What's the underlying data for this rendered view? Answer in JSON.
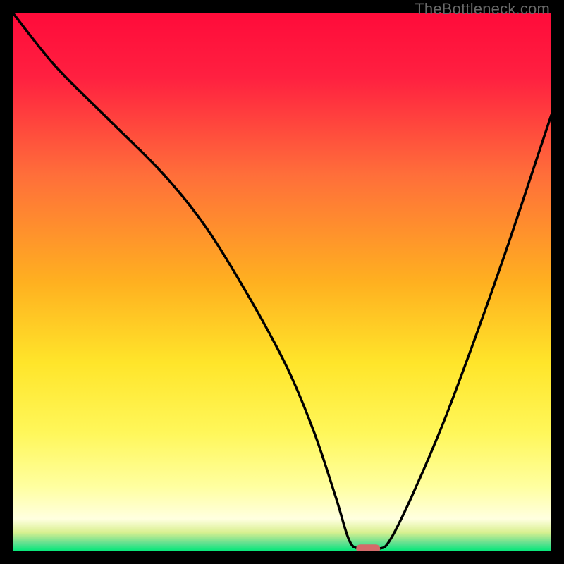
{
  "watermark": "TheBottleneck.com",
  "chart_data": {
    "type": "line",
    "title": "",
    "xlabel": "",
    "ylabel": "",
    "xlim": [
      0,
      100
    ],
    "ylim": [
      0,
      100
    ],
    "x": [
      0,
      8,
      18,
      28,
      36,
      44,
      51,
      56,
      60,
      62.5,
      64.5,
      68,
      70,
      74,
      80,
      86,
      92,
      98,
      100
    ],
    "values": [
      100,
      90,
      80,
      70,
      60,
      47,
      34,
      22,
      10,
      2,
      0.5,
      0.5,
      2,
      10,
      24,
      40,
      57,
      75,
      81
    ],
    "marker": {
      "x": 66,
      "y": 0.5,
      "color": "#d46a6a"
    },
    "gradient_stops": [
      {
        "offset": 0,
        "color": "#ff0b3a"
      },
      {
        "offset": 0.12,
        "color": "#ff2040"
      },
      {
        "offset": 0.3,
        "color": "#ff6e3a"
      },
      {
        "offset": 0.5,
        "color": "#ffb020"
      },
      {
        "offset": 0.65,
        "color": "#ffe52a"
      },
      {
        "offset": 0.78,
        "color": "#fff75a"
      },
      {
        "offset": 0.88,
        "color": "#ffffa0"
      },
      {
        "offset": 0.94,
        "color": "#ffffe0"
      },
      {
        "offset": 0.965,
        "color": "#d8f090"
      },
      {
        "offset": 0.985,
        "color": "#60e090"
      },
      {
        "offset": 1.0,
        "color": "#00e878"
      }
    ]
  }
}
